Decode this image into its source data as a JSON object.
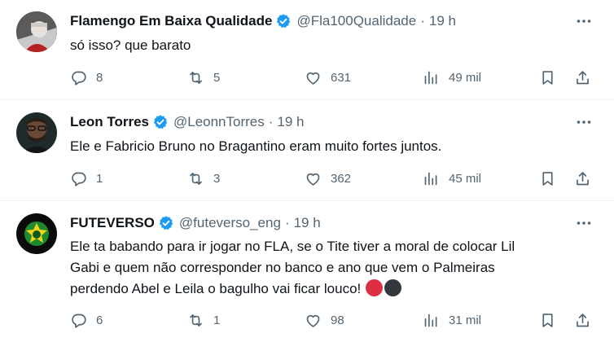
{
  "tweets": [
    {
      "name": "Flamengo Em Baixa Qualidade",
      "handle": "@Fla100Qualidade",
      "time": "19 h",
      "text": "só isso? que barato",
      "replies": "8",
      "retweets": "5",
      "likes": "631",
      "views": "49 mil"
    },
    {
      "name": "Leon Torres",
      "handle": "@LeonnTorres",
      "time": "19 h",
      "text": "Ele e Fabricio Bruno no Bragantino eram muito fortes juntos.",
      "replies": "1",
      "retweets": "3",
      "likes": "362",
      "views": "45 mil"
    },
    {
      "name": "FUTEVERSO",
      "handle": "@futeverso_eng",
      "time": "19 h",
      "text_lines": [
        "Ele ta babando para ir jogar no FLA, se o Tite tiver a moral de colocar Lil",
        "Gabi e quem não corresponder no banco e ano que vem o Palmeiras",
        "perdendo Abel e Leila o bagulho vai ficar louco!"
      ],
      "replies": "6",
      "retweets": "1",
      "likes": "98",
      "views": "31 mil"
    }
  ],
  "separator": "·",
  "colors": {
    "verified": "#1d9bf0",
    "muted": "#536471",
    "text": "#0f1419",
    "red_circle": "#dd2e44",
    "black_circle": "#31373d"
  }
}
